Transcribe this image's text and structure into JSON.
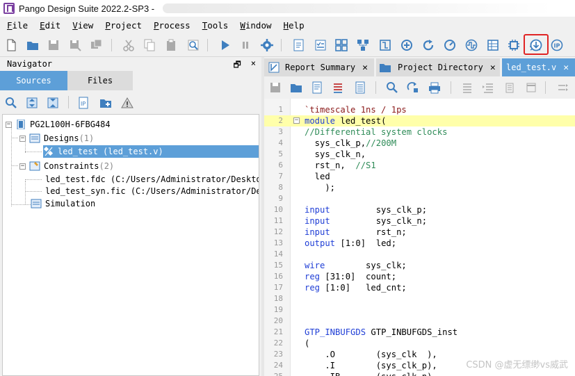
{
  "window": {
    "title": "Pango Design Suite 2022.2-SP3 -"
  },
  "menu": [
    {
      "mnemonic": "F",
      "rest": "ile"
    },
    {
      "mnemonic": "E",
      "rest": "dit"
    },
    {
      "mnemonic": "V",
      "rest": "iew"
    },
    {
      "mnemonic": "P",
      "rest": "roject"
    },
    {
      "mnemonic": "P",
      "rest": "rocess"
    },
    {
      "mnemonic": "T",
      "rest": "ools"
    },
    {
      "mnemonic": "W",
      "rest": "indow"
    },
    {
      "mnemonic": "H",
      "rest": "elp"
    }
  ],
  "toolbar_icons": [
    "new-file-icon",
    "open-folder-icon",
    "save-icon",
    "save-as-icon",
    "save-all-icon",
    "cut-icon",
    "copy-icon",
    "paste-icon",
    "find-icon",
    "run-icon",
    "pause-icon",
    "settings-icon",
    "report-icon",
    "checklist-icon",
    "grid-icon",
    "network-icon",
    "synthesis-icon",
    "refresh-icon",
    "gauge-icon",
    "waveform-icon",
    "table-icon",
    "chip-icon",
    "debug-icon",
    "download-icon",
    "ip-icon"
  ],
  "navigator": {
    "title": "Navigator",
    "pin": "🗗",
    "close": "×",
    "tabs": {
      "sources": "Sources",
      "files": "Files"
    },
    "tree": {
      "device": "PG2L100H-6FBG484",
      "designs_label": "Designs",
      "designs_count": "(1)",
      "design_file": "led_test (led_test.v)",
      "constraints_label": "Constraints",
      "constraints_count": "(2)",
      "fdc_file": "led_test.fdc (C:/Users/Administrator/Desktop",
      "syn_fic_file": "led_test_syn.fic (C:/Users/Administrator/Des",
      "simulation_label": "Simulation"
    }
  },
  "editor_tabs": {
    "report_summary": "Report Summary",
    "project_directory": "Project Directory",
    "led_test": "led_test.v",
    "close": "✕"
  },
  "code": {
    "current_line": 2,
    "lines": [
      [
        [
          "dir",
          "`timescale 1ns / 1ps"
        ]
      ],
      [
        [
          "kw",
          "module"
        ],
        [
          "t",
          " led_test("
        ]
      ],
      [
        [
          "cm",
          "//Differential system clocks"
        ]
      ],
      [
        [
          "t",
          "  sys_clk_p,"
        ],
        [
          "cm",
          "//200M"
        ]
      ],
      [
        [
          "t",
          "  sys_clk_n,"
        ]
      ],
      [
        [
          "t",
          "  rst_n,  "
        ],
        [
          "cm",
          "//S1"
        ]
      ],
      [
        [
          "t",
          "  led"
        ]
      ],
      [
        [
          "t",
          "    );"
        ]
      ],
      [],
      [
        [
          "kw",
          "input"
        ],
        [
          "t",
          "         sys_clk_p;"
        ]
      ],
      [
        [
          "kw",
          "input"
        ],
        [
          "t",
          "         sys_clk_n;"
        ]
      ],
      [
        [
          "kw",
          "input"
        ],
        [
          "t",
          "         rst_n;"
        ]
      ],
      [
        [
          "kw",
          "output"
        ],
        [
          "t",
          " [1:0]  led;"
        ]
      ],
      [],
      [
        [
          "kw",
          "wire"
        ],
        [
          "t",
          "        sys_clk;"
        ]
      ],
      [
        [
          "kw",
          "reg"
        ],
        [
          "t",
          " [31:0]  count;"
        ]
      ],
      [
        [
          "kw",
          "reg"
        ],
        [
          "t",
          " [1:0]   led_cnt;"
        ]
      ],
      [],
      [],
      [],
      [
        [
          "kw",
          "GTP_INBUFGDS"
        ],
        [
          "t",
          " GTP_INBUFGDS_inst"
        ]
      ],
      [
        [
          "t",
          "("
        ]
      ],
      [
        [
          "t",
          "    .O        (sys_clk  ),"
        ]
      ],
      [
        [
          "t",
          "    .I        (sys_clk_p),"
        ]
      ],
      [
        [
          "t",
          "    .IB       (sys_clk_n)"
        ]
      ]
    ]
  },
  "watermark": "CSDN @虚无缥缈vs威武"
}
